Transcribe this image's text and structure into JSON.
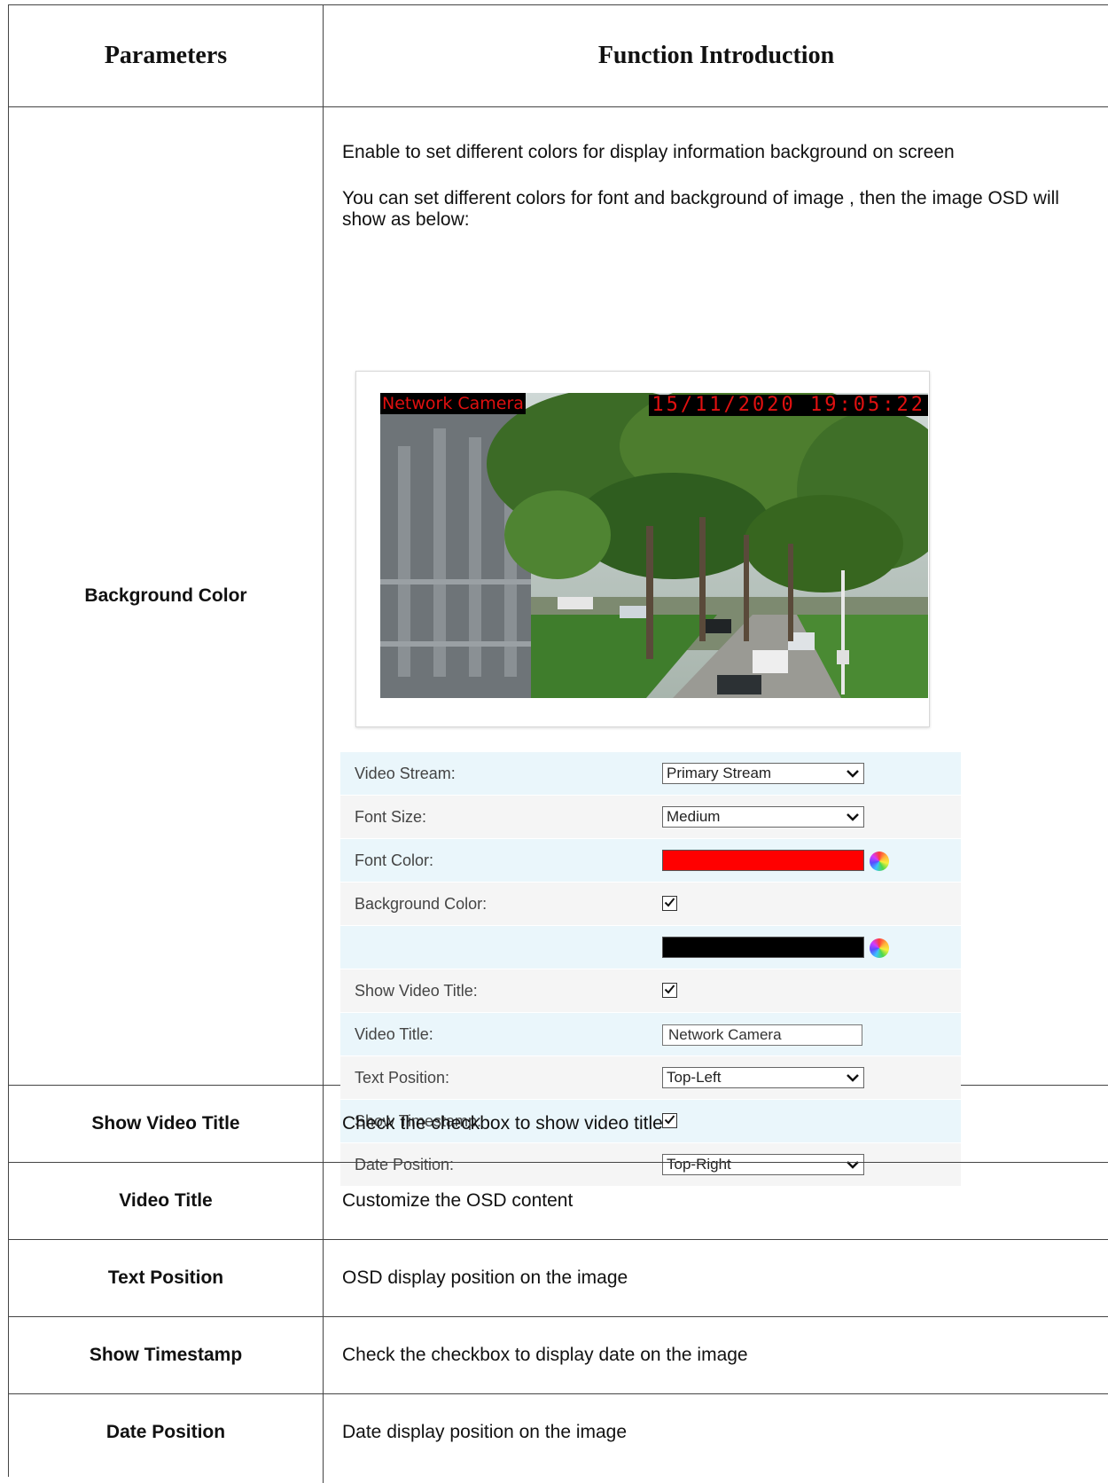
{
  "header": {
    "col1": "Parameters",
    "col2": "Function Introduction"
  },
  "background_color": {
    "param": "Background Color",
    "desc1": "Enable to set different colors for display information background on screen",
    "desc2": "You can set different colors for font and background of image , then the image OSD will show as below:",
    "osd_title": "Network Camera",
    "osd_date": "15/11/2020 19:05:22",
    "panel": {
      "video_stream_label": "Video Stream:",
      "video_stream_value": "Primary Stream",
      "font_size_label": "Font Size:",
      "font_size_value": "Medium",
      "font_color_label": "Font Color:",
      "font_color_hex": "#ff0000",
      "background_color_label": "Background Color:",
      "background_color_checked": true,
      "background_color_hex": "#000000",
      "show_video_title_label": "Show Video Title:",
      "show_video_title_checked": true,
      "video_title_label": "Video Title:",
      "video_title_value": "Network Camera",
      "text_position_label": "Text Position:",
      "text_position_value": "Top-Left",
      "show_timestamp_label": "Show Timestamp:",
      "show_timestamp_checked": true,
      "date_position_label": "Date Position:",
      "date_position_value": "Top-Right"
    }
  },
  "rows": [
    {
      "param": "Show Video Title",
      "desc": "Check the checkbox to show video title"
    },
    {
      "param": "Video Title",
      "desc": "Customize the OSD content"
    },
    {
      "param": "Text Position",
      "desc": "OSD display position on the image"
    },
    {
      "param": "Show Timestamp",
      "desc": "Check the checkbox to display date on the image"
    },
    {
      "param": "Date Position",
      "desc": "Date display position on the image"
    }
  ]
}
